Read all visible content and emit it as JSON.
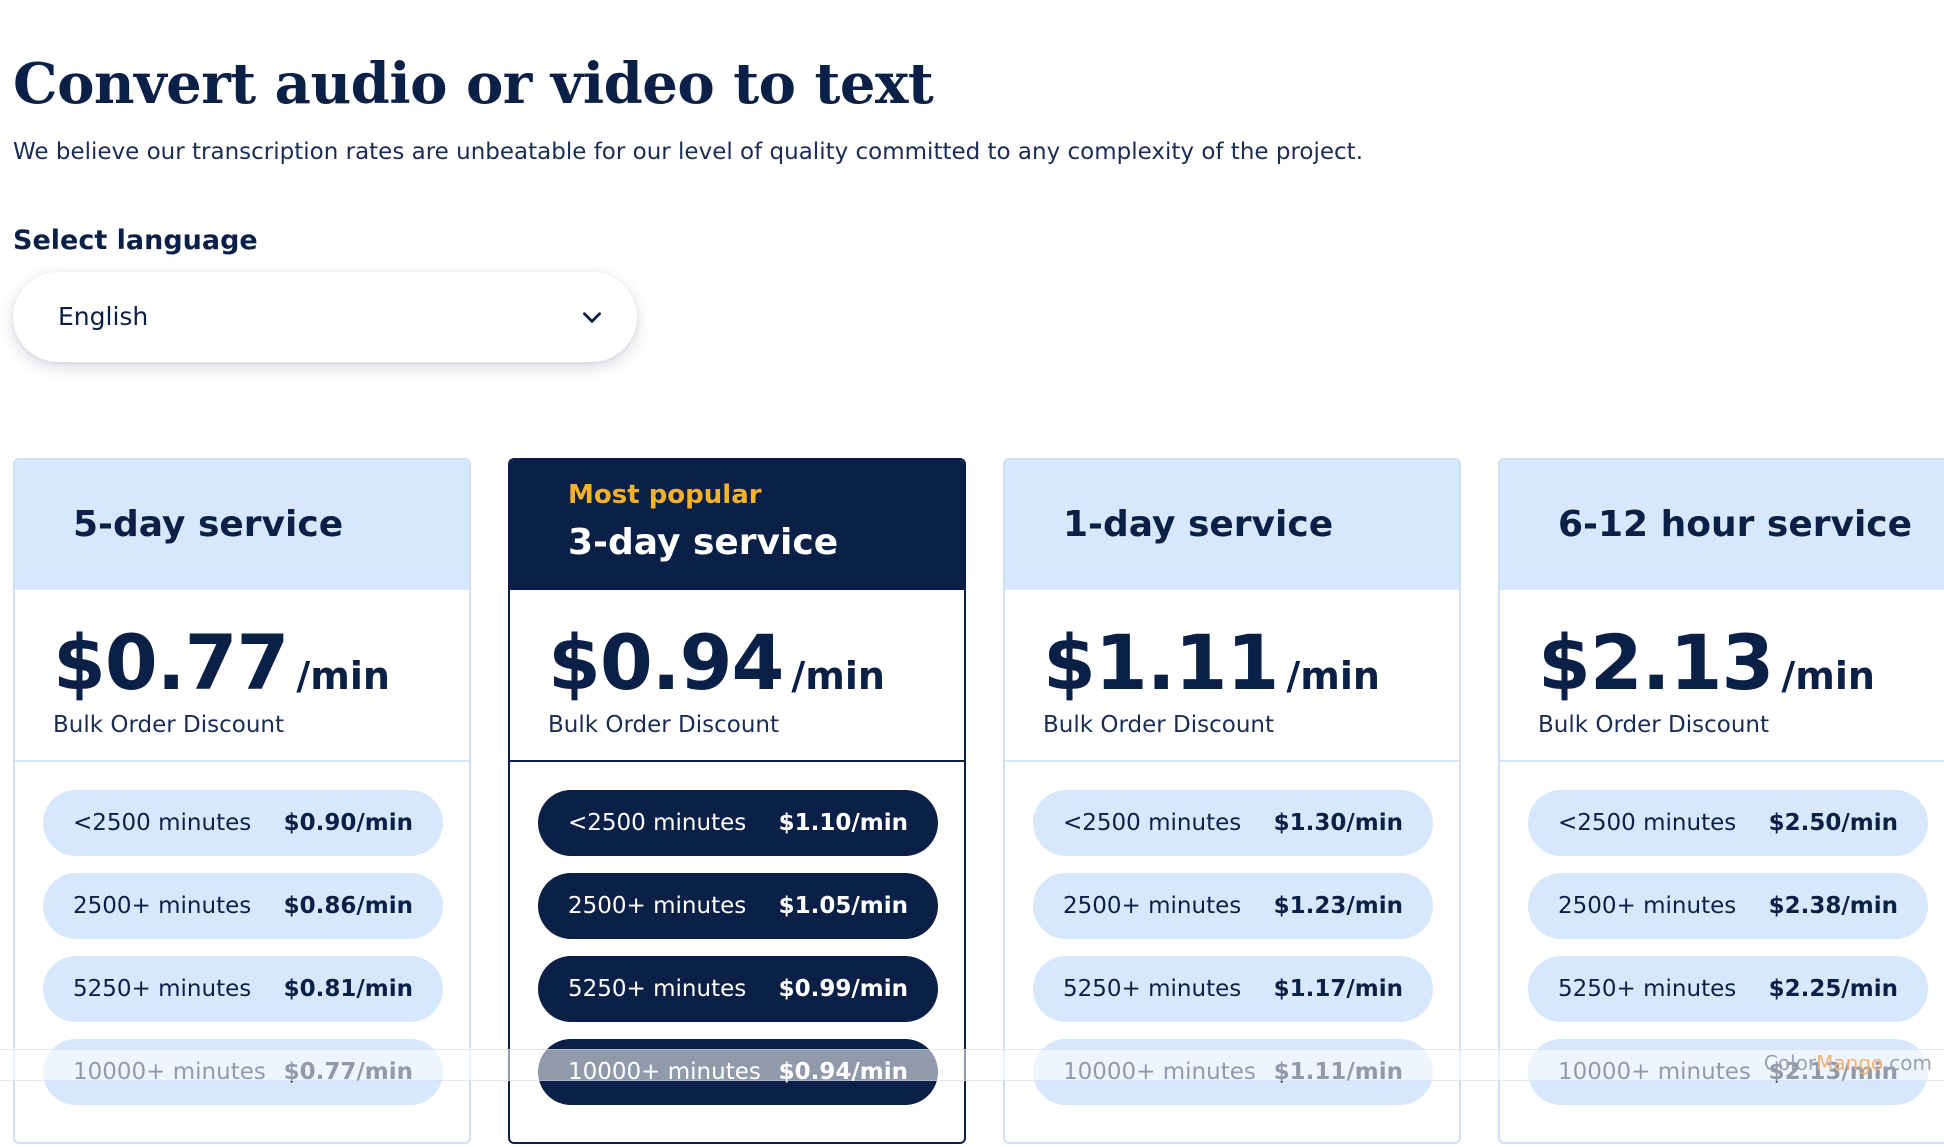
{
  "header": {
    "title": "Convert audio or video to text",
    "subtitle": "We believe our transcription rates are unbeatable for our level of quality committed to any complexity of the project."
  },
  "language": {
    "label": "Select language",
    "selected": "English",
    "icon": "chevron-down-icon"
  },
  "plans": [
    {
      "badge": "",
      "title": "5-day service",
      "price": "$0.77",
      "unit": "/min",
      "bulk_label": "Bulk Order Discount",
      "tiers": [
        {
          "label": "<2500 minutes",
          "price": "$0.90/min"
        },
        {
          "label": "2500+ minutes",
          "price": "$0.86/min"
        },
        {
          "label": "5250+ minutes",
          "price": "$0.81/min"
        },
        {
          "label": "10000+ minutes",
          "price": "$0.77/min"
        }
      ]
    },
    {
      "badge": "Most popular",
      "title": "3-day service",
      "price": "$0.94",
      "unit": "/min",
      "bulk_label": "Bulk Order Discount",
      "tiers": [
        {
          "label": "<2500 minutes",
          "price": "$1.10/min"
        },
        {
          "label": "2500+ minutes",
          "price": "$1.05/min"
        },
        {
          "label": "5250+ minutes",
          "price": "$0.99/min"
        },
        {
          "label": "10000+ minutes",
          "price": "$0.94/min"
        }
      ]
    },
    {
      "badge": "",
      "title": "1-day service",
      "price": "$1.11",
      "unit": "/min",
      "bulk_label": "Bulk Order Discount",
      "tiers": [
        {
          "label": "<2500 minutes",
          "price": "$1.30/min"
        },
        {
          "label": "2500+ minutes",
          "price": "$1.23/min"
        },
        {
          "label": "5250+ minutes",
          "price": "$1.17/min"
        },
        {
          "label": "10000+ minutes",
          "price": "$1.11/min"
        }
      ]
    },
    {
      "badge": "",
      "title": "6-12 hour service",
      "price": "$2.13",
      "unit": "/min",
      "bulk_label": "Bulk Order Discount",
      "tiers": [
        {
          "label": "<2500 minutes",
          "price": "$2.50/min"
        },
        {
          "label": "2500+ minutes",
          "price": "$2.38/min"
        },
        {
          "label": "5250+ minutes",
          "price": "$2.25/min"
        },
        {
          "label": "10000+ minutes",
          "price": "$2.13/min"
        }
      ]
    }
  ],
  "watermark": {
    "prefix": "Color",
    "middle": "Mango",
    "suffix": ".com"
  },
  "colors": {
    "navy": "#0b2046",
    "light_blue": "#d7e8fc",
    "badge_gold": "#f4b12a",
    "white": "#ffffff"
  }
}
